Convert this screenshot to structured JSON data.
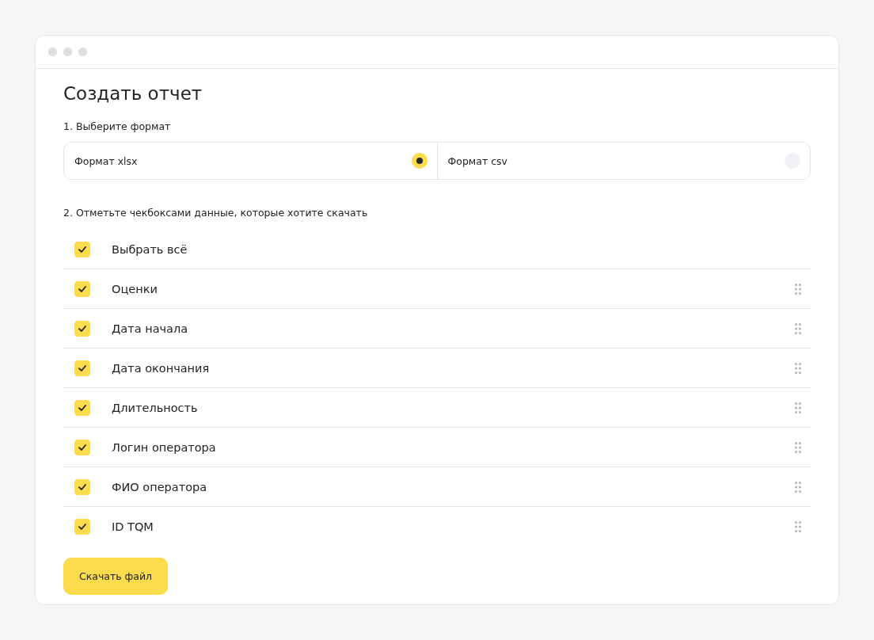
{
  "window": {
    "title": "Создать отчет"
  },
  "format_step": {
    "label": "1. Выберите формат",
    "options": [
      {
        "label": "Формат xlsx",
        "selected": true
      },
      {
        "label": "Формат csv",
        "selected": false
      }
    ]
  },
  "fields_step": {
    "label": "2. Отметьте чекбоксами данные, которые хотите скачать",
    "items": [
      {
        "kind": "select_all",
        "label": "Выбрать всё",
        "checked": true
      },
      {
        "kind": "field",
        "label": "Оценки",
        "checked": true
      },
      {
        "kind": "field",
        "label": "Дата начала",
        "checked": true
      },
      {
        "kind": "field",
        "label": "Дата окончания",
        "checked": true
      },
      {
        "kind": "field",
        "label": "Длительность",
        "checked": true
      },
      {
        "kind": "field",
        "label": "Логин оператора",
        "checked": true
      },
      {
        "kind": "field",
        "label": "ФИО оператора",
        "checked": true
      },
      {
        "kind": "field",
        "label": "ID TQM",
        "checked": true
      }
    ]
  },
  "download_button": "Скачать файл"
}
